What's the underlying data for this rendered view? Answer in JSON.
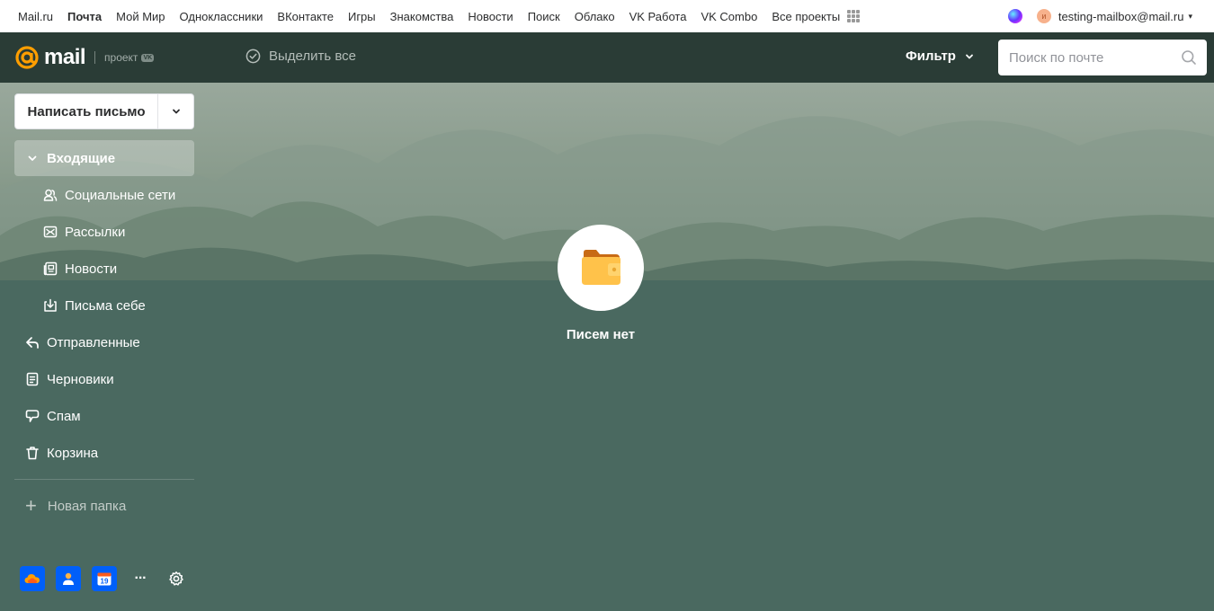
{
  "portal": {
    "links": [
      {
        "label": "Mail.ru",
        "active": false
      },
      {
        "label": "Почта",
        "active": true
      },
      {
        "label": "Мой Мир",
        "active": false
      },
      {
        "label": "Одноклассники",
        "active": false
      },
      {
        "label": "ВКонтакте",
        "active": false
      },
      {
        "label": "Игры",
        "active": false
      },
      {
        "label": "Знакомства",
        "active": false
      },
      {
        "label": "Новости",
        "active": false
      },
      {
        "label": "Поиск",
        "active": false
      },
      {
        "label": "Облако",
        "active": false
      },
      {
        "label": "VK Работа",
        "active": false
      },
      {
        "label": "VK Combo",
        "active": false
      },
      {
        "label": "Все проекты",
        "active": false
      }
    ],
    "avatar_letter": "и",
    "account": "testing-mailbox@mail.ru",
    "caret": "▾"
  },
  "header": {
    "logo_text": "mail",
    "logo_project": "проект",
    "logo_vk": "VK",
    "select_all": "Выделить все",
    "filter": "Фильтр",
    "search_placeholder": "Поиск по почте"
  },
  "sidebar": {
    "compose": "Написать письмо",
    "folders": [
      {
        "label": "Входящие",
        "icon": "chevron-down-icon",
        "active": true,
        "sub": false
      },
      {
        "label": "Социальные сети",
        "icon": "people-icon",
        "active": false,
        "sub": true
      },
      {
        "label": "Рассылки",
        "icon": "newsletter-icon",
        "active": false,
        "sub": true
      },
      {
        "label": "Новости",
        "icon": "news-icon",
        "active": false,
        "sub": true
      },
      {
        "label": "Письма себе",
        "icon": "to-self-icon",
        "active": false,
        "sub": true
      },
      {
        "label": "Отправленные",
        "icon": "sent-icon",
        "active": false,
        "sub": false
      },
      {
        "label": "Черновики",
        "icon": "draft-icon",
        "active": false,
        "sub": false
      },
      {
        "label": "Спам",
        "icon": "spam-icon",
        "active": false,
        "sub": false
      },
      {
        "label": "Корзина",
        "icon": "trash-icon",
        "active": false,
        "sub": false
      }
    ],
    "new_folder": "Новая папка",
    "new_folder_plus": "+",
    "calendar_day": "19",
    "more": "···"
  },
  "empty_state": {
    "text": "Писем нет"
  },
  "colors": {
    "accent": "#005ff9",
    "header_bg": "#2a3c36",
    "page_bg": "#4a6960",
    "logo_orange": "#ff9e00"
  }
}
